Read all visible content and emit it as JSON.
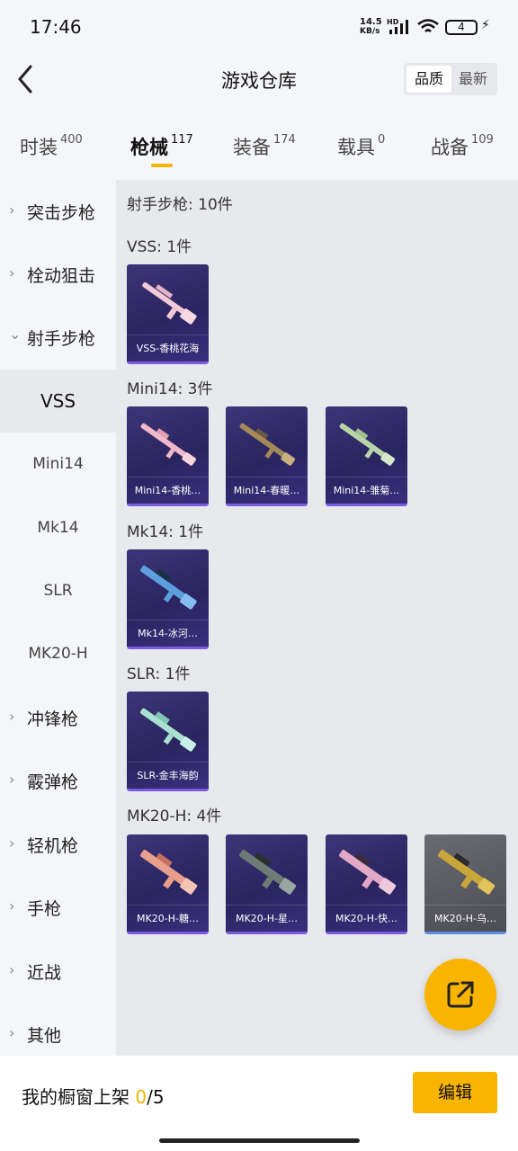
{
  "status_bar": {
    "time": "17:46",
    "net_speed_top": "14.5",
    "net_speed_bottom": "KB/s",
    "hd": "HD",
    "battery": "4"
  },
  "header": {
    "title": "游戏仓库",
    "sort_quality": "品质",
    "sort_newest": "最新"
  },
  "tabs": [
    {
      "label": "时装",
      "count": "400"
    },
    {
      "label": "枪械",
      "count": "117"
    },
    {
      "label": "装备",
      "count": "174"
    },
    {
      "label": "载具",
      "count": "0"
    },
    {
      "label": "战备",
      "count": "109"
    }
  ],
  "sidebar": {
    "categories": [
      "突击步枪",
      "栓动狙击",
      "射手步枪"
    ],
    "subitems": [
      "VSS",
      "Mini14",
      "Mk14",
      "SLR",
      "MK20-H"
    ],
    "more_categories": [
      "冲锋枪",
      "霰弹枪",
      "轻机枪",
      "手枪",
      "近战",
      "其他"
    ]
  },
  "content": {
    "summary": "射手步枪: 10件",
    "groups": [
      {
        "label": "VSS: 1件",
        "items": [
          "VSS-香桃花海"
        ]
      },
      {
        "label": "Mini14: 3件",
        "items": [
          "Mini14-香桃…",
          "Mini14-春暖…",
          "Mini14-雏菊…"
        ]
      },
      {
        "label": "Mk14: 1件",
        "items": [
          "Mk14-冰河…"
        ]
      },
      {
        "label": "SLR: 1件",
        "items": [
          "SLR-金丰海韵"
        ]
      },
      {
        "label": "MK20-H: 4件",
        "items": [
          "MK20-H-糖…",
          "MK20-H-星…",
          "MK20-H-快…",
          "MK20-H-乌…"
        ]
      }
    ]
  },
  "footer": {
    "label": "我的橱窗上架 ",
    "current": "0",
    "total": "/5",
    "edit": "编辑"
  },
  "colors": {
    "accent": "#f9b400",
    "card_purple": "#2a2460",
    "card_grey": "#4c4c54"
  }
}
